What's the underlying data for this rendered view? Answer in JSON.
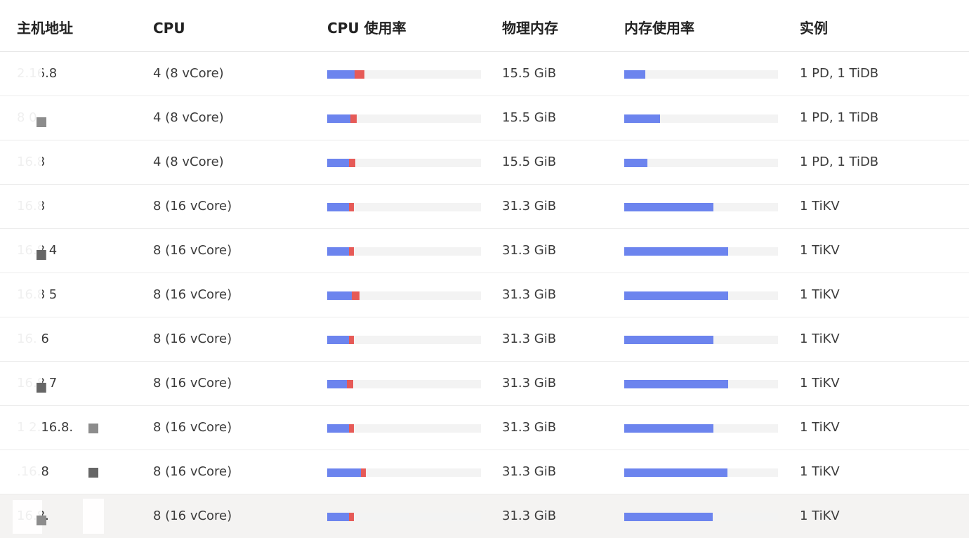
{
  "columns": {
    "host": "主机地址",
    "cpu": "CPU",
    "cpu_usage": "CPU 使用率",
    "memory": "物理内存",
    "mem_usage": "内存使用率",
    "instances": "实例"
  },
  "colors": {
    "user_cpu": "#6c84ee",
    "system_cpu": "#e65a57",
    "memory_used": "#6c84ee",
    "bar_track": "#f3f3f3"
  },
  "rows": [
    {
      "host": "2.16.8",
      "cpu": "4 (8 vCore)",
      "cpu_user": 0.18,
      "cpu_sys": 0.065,
      "memory": "15.5 GiB",
      "mem_used": 0.135,
      "instances": "1 PD, 1 TiDB"
    },
    {
      "host": "8  0",
      "cpu": "4 (8 vCore)",
      "cpu_user": 0.15,
      "cpu_sys": 0.04,
      "memory": "15.5 GiB",
      "mem_used": 0.235,
      "instances": "1 PD, 1 TiDB"
    },
    {
      "host": "16.8",
      "cpu": "4 (8 vCore)",
      "cpu_user": 0.14,
      "cpu_sys": 0.04,
      "memory": "15.5 GiB",
      "mem_used": 0.15,
      "instances": "1 PD, 1 TiDB"
    },
    {
      "host": "16.8",
      "cpu": "8 (16 vCore)",
      "cpu_user": 0.14,
      "cpu_sys": 0.03,
      "memory": "31.3 GiB",
      "mem_used": 0.58,
      "instances": "1 TiKV"
    },
    {
      "host": "16.8  4",
      "cpu": "8 (16 vCore)",
      "cpu_user": 0.14,
      "cpu_sys": 0.03,
      "memory": "31.3 GiB",
      "mem_used": 0.675,
      "instances": "1 TiKV"
    },
    {
      "host": "16.8  5",
      "cpu": "8 (16 vCore)",
      "cpu_user": 0.16,
      "cpu_sys": 0.05,
      "memory": "31.3 GiB",
      "mem_used": 0.675,
      "instances": "1 TiKV"
    },
    {
      "host": "16.  6",
      "cpu": "8 (16 vCore)",
      "cpu_user": 0.14,
      "cpu_sys": 0.03,
      "memory": "31.3 GiB",
      "mem_used": 0.58,
      "instances": "1 TiKV"
    },
    {
      "host": "16.8  7",
      "cpu": "8 (16 vCore)",
      "cpu_user": 0.13,
      "cpu_sys": 0.04,
      "memory": "31.3 GiB",
      "mem_used": 0.675,
      "instances": "1 TiKV"
    },
    {
      "host": "1 2.16.8.",
      "cpu": "8 (16 vCore)",
      "cpu_user": 0.14,
      "cpu_sys": 0.03,
      "memory": "31.3 GiB",
      "mem_used": 0.58,
      "instances": "1 TiKV"
    },
    {
      "host": ".16.8",
      "cpu": "8 (16 vCore)",
      "cpu_user": 0.22,
      "cpu_sys": 0.03,
      "memory": "31.3 GiB",
      "mem_used": 0.67,
      "instances": "1 TiKV"
    },
    {
      "host": "16.8.",
      "cpu": "8 (16 vCore)",
      "cpu_user": 0.14,
      "cpu_sys": 0.03,
      "memory": "31.3 GiB",
      "mem_used": 0.575,
      "instances": "1 TiKV"
    }
  ]
}
